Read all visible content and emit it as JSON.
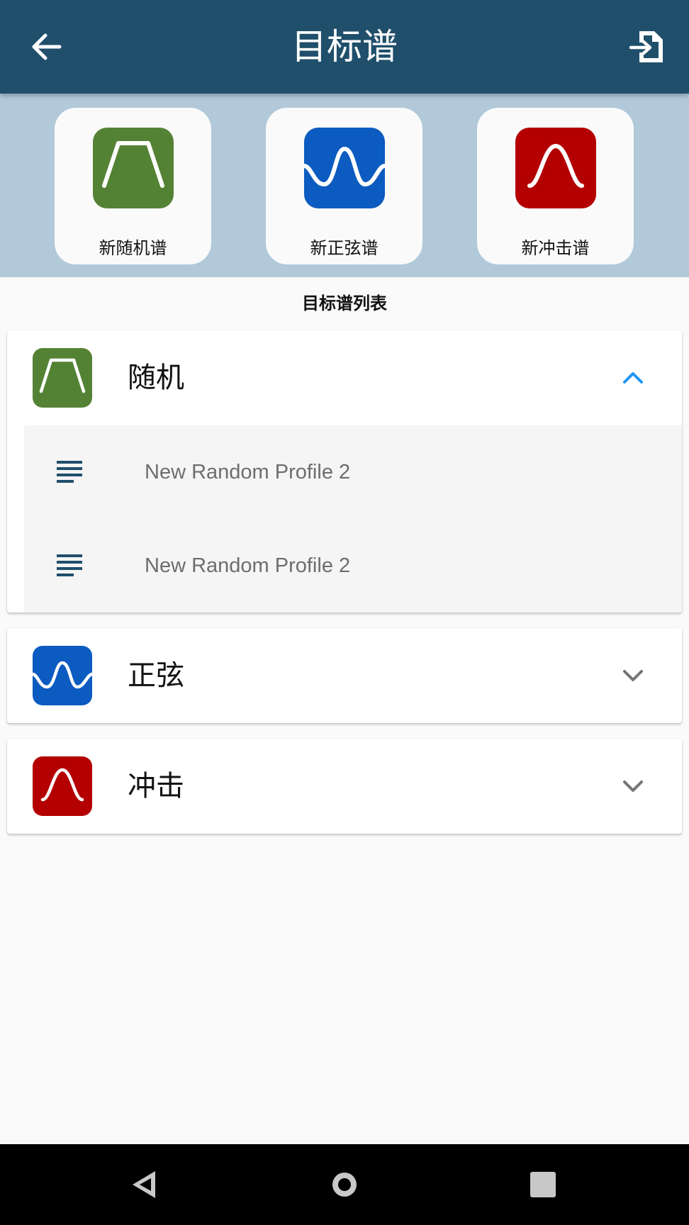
{
  "app_bar": {
    "title": "目标谱",
    "back_icon": "arrow-left-icon",
    "import_icon": "file-import-icon",
    "color": "#1f4f6b"
  },
  "new_profiles": {
    "background": "#b1c9d9",
    "cards": [
      {
        "label": "新随机谱",
        "icon": "trapezoid-icon",
        "color": "#548235"
      },
      {
        "label": "新正弦谱",
        "icon": "sine-wave-icon",
        "color": "#0b5bc0"
      },
      {
        "label": "新冲击谱",
        "icon": "pulse-icon",
        "color": "#b40000"
      }
    ]
  },
  "profile_list": {
    "title": "目标谱列表",
    "categories": [
      {
        "label": "随机",
        "icon": "trapezoid-icon",
        "color": "#548235",
        "expanded": true,
        "chevron": "chevron-up-icon",
        "items": [
          {
            "label": "New Random Profile 2",
            "icon": "list-lines-icon"
          },
          {
            "label": "New Random Profile 2",
            "icon": "list-lines-icon"
          }
        ]
      },
      {
        "label": "正弦",
        "icon": "sine-wave-icon",
        "color": "#0b5bc0",
        "expanded": false,
        "chevron": "chevron-down-icon",
        "items": []
      },
      {
        "label": "冲击",
        "icon": "pulse-icon",
        "color": "#b40000",
        "expanded": false,
        "chevron": "chevron-down-icon",
        "items": []
      }
    ]
  },
  "system_nav": {
    "buttons": [
      "nav-back-icon",
      "nav-home-icon",
      "nav-recents-icon"
    ]
  },
  "colors": {
    "accent_chevron": "#2196f3",
    "muted_chevron": "#757575",
    "list_icon": "#1f4f6b"
  }
}
